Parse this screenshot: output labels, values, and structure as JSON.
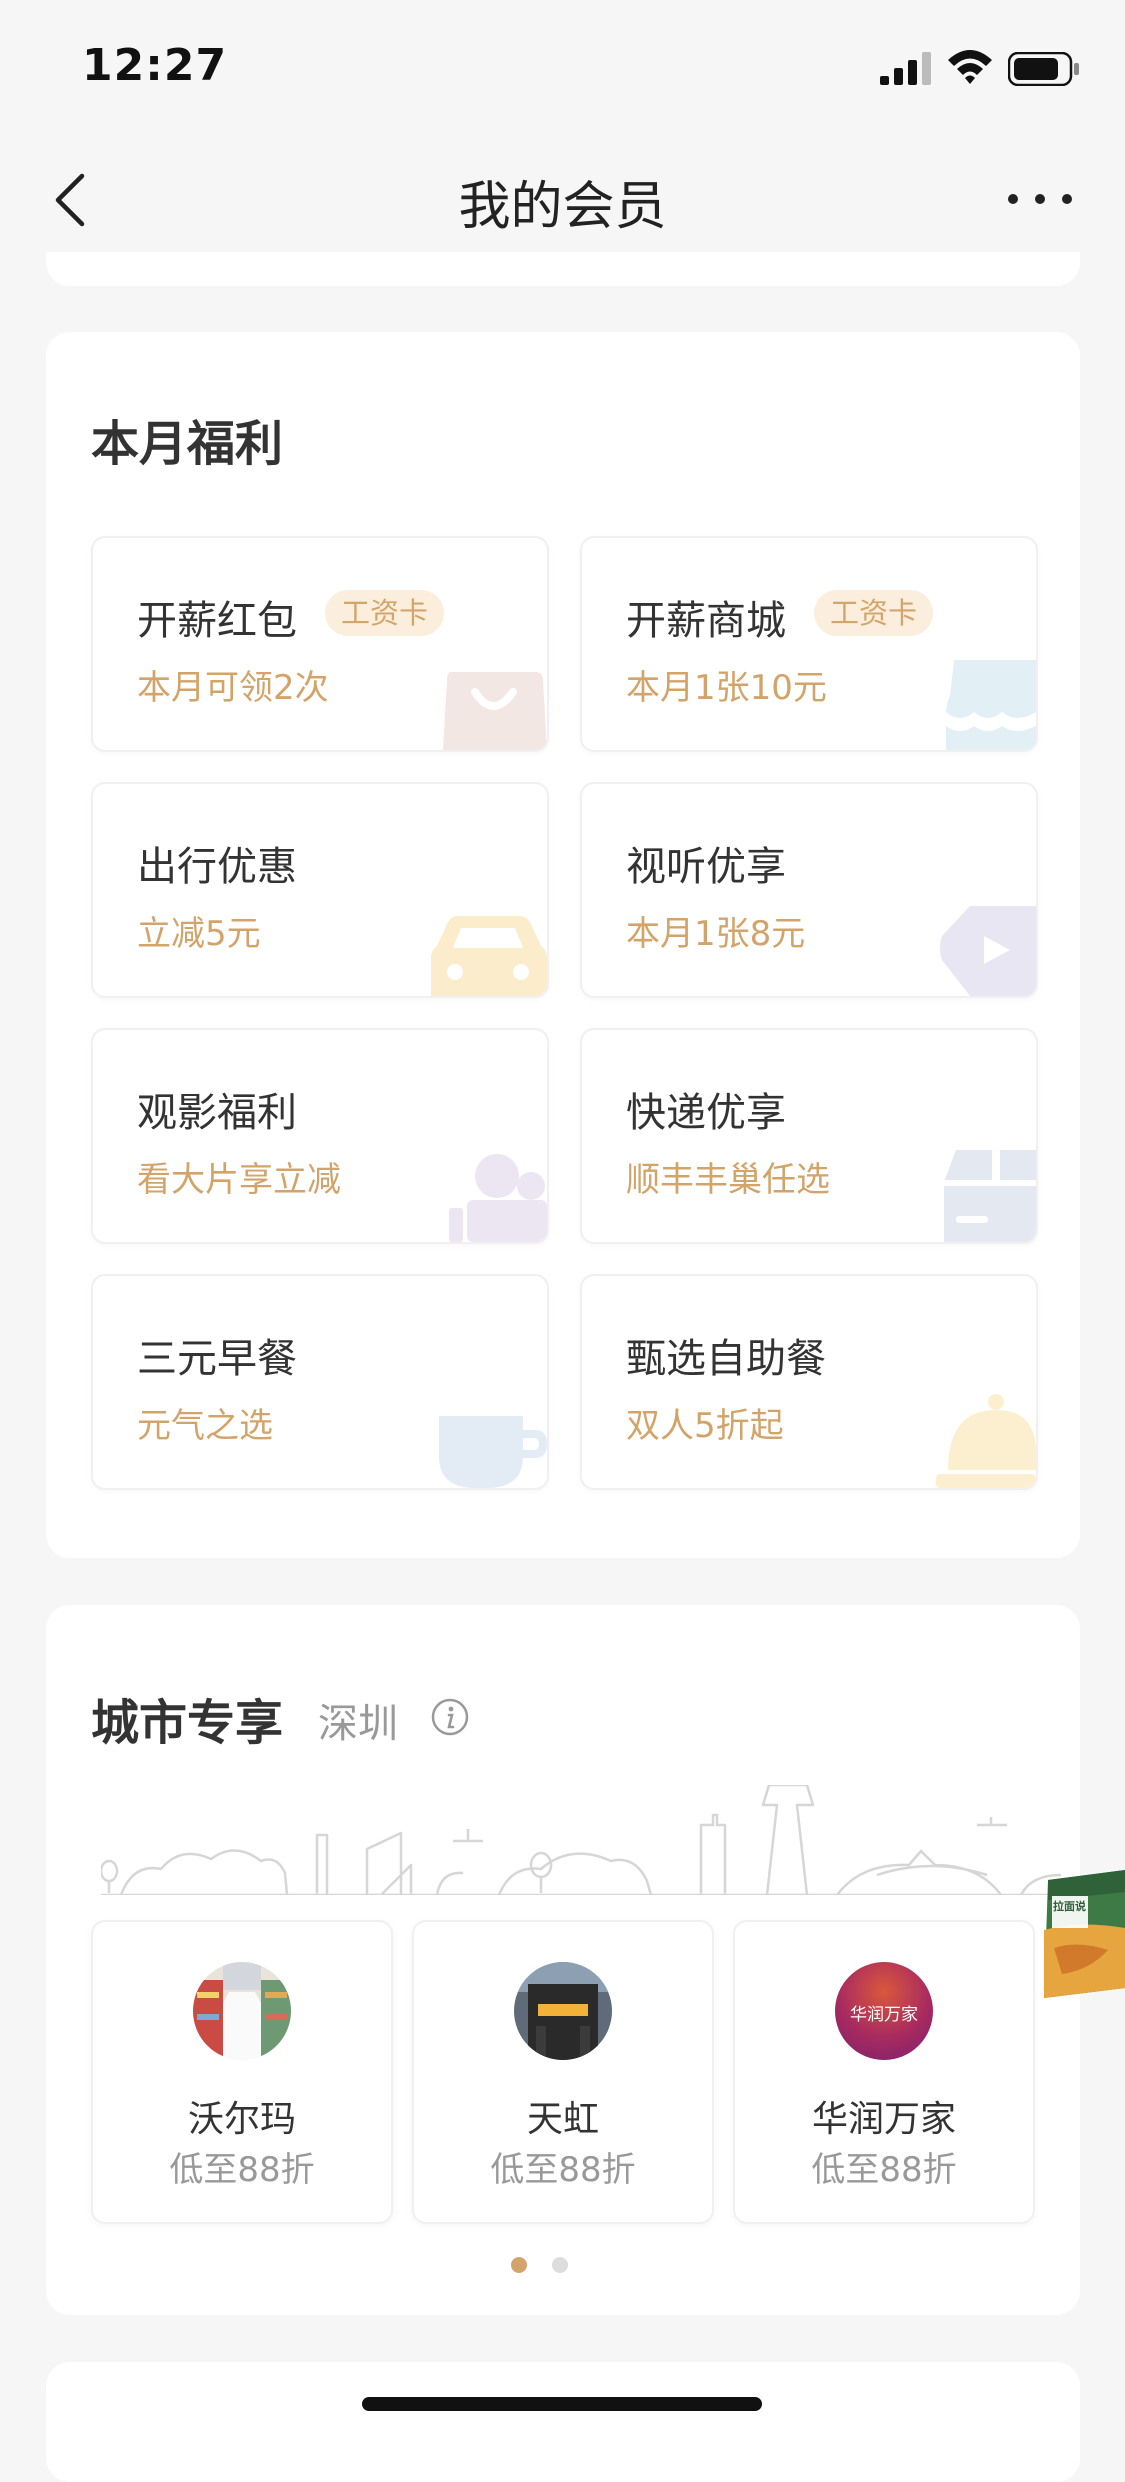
{
  "status_bar": {
    "time": "12:27"
  },
  "nav": {
    "title": "我的会员"
  },
  "benefits": {
    "title": "本月福利",
    "tiles": [
      {
        "title": "开薪红包",
        "tag": "工资卡",
        "subtitle": "本月可领2次",
        "icon": "shopping-bag-icon"
      },
      {
        "title": "开薪商城",
        "tag": "工资卡",
        "subtitle": "本月1张10元",
        "icon": "store-awning-icon"
      },
      {
        "title": "出行优惠",
        "subtitle": "立减5元",
        "icon": "car-icon"
      },
      {
        "title": "视听优享",
        "subtitle": "本月1张8元",
        "icon": "play-icon"
      },
      {
        "title": "观影福利",
        "subtitle": "看大片享立减",
        "icon": "movie-camera-icon"
      },
      {
        "title": "快递优享",
        "subtitle": "顺丰丰巢任选",
        "icon": "package-box-icon"
      },
      {
        "title": "三元早餐",
        "subtitle": "元气之选",
        "icon": "coffee-cup-icon"
      },
      {
        "title": "甄选自助餐",
        "subtitle": "双人5折起",
        "icon": "dining-cloche-icon"
      }
    ]
  },
  "city": {
    "title": "城市专享",
    "city_name": "深圳",
    "stores": [
      {
        "name": "沃尔玛",
        "discount": "低至88折",
        "logo": "walmart-store-logo"
      },
      {
        "name": "天虹",
        "discount": "低至88折",
        "logo": "tianhong-store-logo"
      },
      {
        "name": "华润万家",
        "discount": "低至88折",
        "logo": "vanguard-store-logo",
        "logo_text": "华润万家"
      }
    ],
    "pager": {
      "pages": 2,
      "active": 1
    }
  },
  "float_ad": {
    "text": "拉面说"
  },
  "colors": {
    "accent": "#d4a56b",
    "tag_bg": "#fbeedd",
    "page_bg": "#f6f6f6"
  }
}
